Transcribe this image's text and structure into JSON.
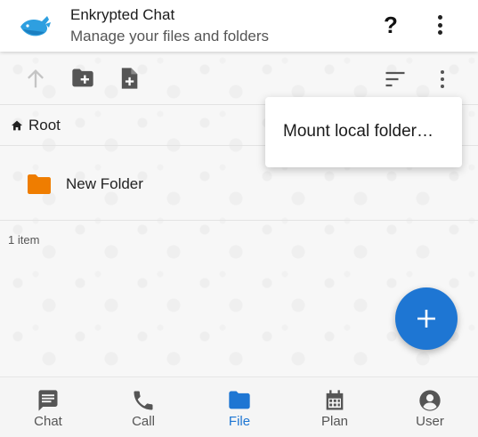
{
  "app": {
    "title": "Enkrypted Chat",
    "subtitle": "Manage your files and folders",
    "help_label": "?"
  },
  "toolbar": {
    "icons": [
      "arrow-up-icon",
      "new-folder-icon",
      "new-file-icon",
      "sort-icon",
      "more-vert-icon"
    ]
  },
  "breadcrumb": {
    "label": "Root"
  },
  "files": [
    {
      "name": "New Folder",
      "type": "folder"
    }
  ],
  "status": {
    "item_count": "1 item"
  },
  "menu": {
    "items": [
      "Mount local folder…"
    ]
  },
  "bottom_nav": {
    "items": [
      {
        "label": "Chat",
        "icon": "chat-icon",
        "active": false
      },
      {
        "label": "Call",
        "icon": "phone-icon",
        "active": false
      },
      {
        "label": "File",
        "icon": "folder-icon",
        "active": true
      },
      {
        "label": "Plan",
        "icon": "calendar-icon",
        "active": false
      },
      {
        "label": "User",
        "icon": "user-icon",
        "active": false
      }
    ]
  },
  "colors": {
    "accent": "#1e76d3",
    "folder": "#ef7d00",
    "icon_dark": "#555555",
    "icon_disabled": "#c4c4c4"
  }
}
